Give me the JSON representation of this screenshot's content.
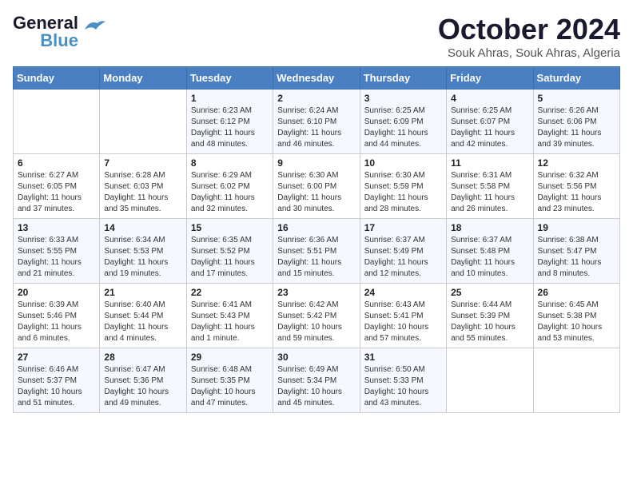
{
  "logo": {
    "line1": "General",
    "line2": "Blue"
  },
  "title": "October 2024",
  "subtitle": "Souk Ahras, Souk Ahras, Algeria",
  "weekdays": [
    "Sunday",
    "Monday",
    "Tuesday",
    "Wednesday",
    "Thursday",
    "Friday",
    "Saturday"
  ],
  "weeks": [
    [
      null,
      null,
      {
        "day": 1,
        "sunrise": "6:23 AM",
        "sunset": "6:12 PM",
        "daylight": "11 hours and 48 minutes."
      },
      {
        "day": 2,
        "sunrise": "6:24 AM",
        "sunset": "6:10 PM",
        "daylight": "11 hours and 46 minutes."
      },
      {
        "day": 3,
        "sunrise": "6:25 AM",
        "sunset": "6:09 PM",
        "daylight": "11 hours and 44 minutes."
      },
      {
        "day": 4,
        "sunrise": "6:25 AM",
        "sunset": "6:07 PM",
        "daylight": "11 hours and 42 minutes."
      },
      {
        "day": 5,
        "sunrise": "6:26 AM",
        "sunset": "6:06 PM",
        "daylight": "11 hours and 39 minutes."
      }
    ],
    [
      {
        "day": 6,
        "sunrise": "6:27 AM",
        "sunset": "6:05 PM",
        "daylight": "11 hours and 37 minutes."
      },
      {
        "day": 7,
        "sunrise": "6:28 AM",
        "sunset": "6:03 PM",
        "daylight": "11 hours and 35 minutes."
      },
      {
        "day": 8,
        "sunrise": "6:29 AM",
        "sunset": "6:02 PM",
        "daylight": "11 hours and 32 minutes."
      },
      {
        "day": 9,
        "sunrise": "6:30 AM",
        "sunset": "6:00 PM",
        "daylight": "11 hours and 30 minutes."
      },
      {
        "day": 10,
        "sunrise": "6:30 AM",
        "sunset": "5:59 PM",
        "daylight": "11 hours and 28 minutes."
      },
      {
        "day": 11,
        "sunrise": "6:31 AM",
        "sunset": "5:58 PM",
        "daylight": "11 hours and 26 minutes."
      },
      {
        "day": 12,
        "sunrise": "6:32 AM",
        "sunset": "5:56 PM",
        "daylight": "11 hours and 23 minutes."
      }
    ],
    [
      {
        "day": 13,
        "sunrise": "6:33 AM",
        "sunset": "5:55 PM",
        "daylight": "11 hours and 21 minutes."
      },
      {
        "day": 14,
        "sunrise": "6:34 AM",
        "sunset": "5:53 PM",
        "daylight": "11 hours and 19 minutes."
      },
      {
        "day": 15,
        "sunrise": "6:35 AM",
        "sunset": "5:52 PM",
        "daylight": "11 hours and 17 minutes."
      },
      {
        "day": 16,
        "sunrise": "6:36 AM",
        "sunset": "5:51 PM",
        "daylight": "11 hours and 15 minutes."
      },
      {
        "day": 17,
        "sunrise": "6:37 AM",
        "sunset": "5:49 PM",
        "daylight": "11 hours and 12 minutes."
      },
      {
        "day": 18,
        "sunrise": "6:37 AM",
        "sunset": "5:48 PM",
        "daylight": "11 hours and 10 minutes."
      },
      {
        "day": 19,
        "sunrise": "6:38 AM",
        "sunset": "5:47 PM",
        "daylight": "11 hours and 8 minutes."
      }
    ],
    [
      {
        "day": 20,
        "sunrise": "6:39 AM",
        "sunset": "5:46 PM",
        "daylight": "11 hours and 6 minutes."
      },
      {
        "day": 21,
        "sunrise": "6:40 AM",
        "sunset": "5:44 PM",
        "daylight": "11 hours and 4 minutes."
      },
      {
        "day": 22,
        "sunrise": "6:41 AM",
        "sunset": "5:43 PM",
        "daylight": "11 hours and 1 minute."
      },
      {
        "day": 23,
        "sunrise": "6:42 AM",
        "sunset": "5:42 PM",
        "daylight": "10 hours and 59 minutes."
      },
      {
        "day": 24,
        "sunrise": "6:43 AM",
        "sunset": "5:41 PM",
        "daylight": "10 hours and 57 minutes."
      },
      {
        "day": 25,
        "sunrise": "6:44 AM",
        "sunset": "5:39 PM",
        "daylight": "10 hours and 55 minutes."
      },
      {
        "day": 26,
        "sunrise": "6:45 AM",
        "sunset": "5:38 PM",
        "daylight": "10 hours and 53 minutes."
      }
    ],
    [
      {
        "day": 27,
        "sunrise": "6:46 AM",
        "sunset": "5:37 PM",
        "daylight": "10 hours and 51 minutes."
      },
      {
        "day": 28,
        "sunrise": "6:47 AM",
        "sunset": "5:36 PM",
        "daylight": "10 hours and 49 minutes."
      },
      {
        "day": 29,
        "sunrise": "6:48 AM",
        "sunset": "5:35 PM",
        "daylight": "10 hours and 47 minutes."
      },
      {
        "day": 30,
        "sunrise": "6:49 AM",
        "sunset": "5:34 PM",
        "daylight": "10 hours and 45 minutes."
      },
      {
        "day": 31,
        "sunrise": "6:50 AM",
        "sunset": "5:33 PM",
        "daylight": "10 hours and 43 minutes."
      },
      null,
      null
    ]
  ],
  "labels": {
    "sunrise": "Sunrise:",
    "sunset": "Sunset:",
    "daylight": "Daylight:"
  }
}
